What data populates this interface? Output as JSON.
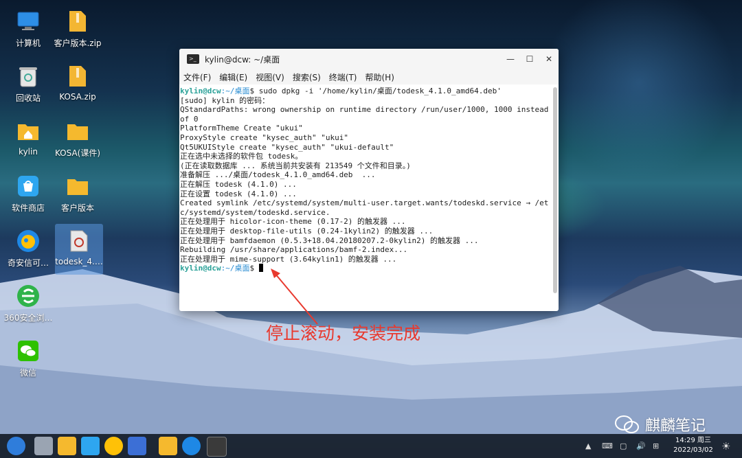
{
  "desktop": {
    "icons": [
      {
        "label": "计算机",
        "icon": "computer-icon"
      },
      {
        "label": "客户版本.zip",
        "icon": "zip-icon"
      },
      {
        "label": "回收站",
        "icon": "trash-icon"
      },
      {
        "label": "KOSA.zip",
        "icon": "zip-icon"
      },
      {
        "label": "kylin",
        "icon": "home-folder-icon"
      },
      {
        "label": "KOSA(课件)",
        "icon": "folder-icon"
      },
      {
        "label": "软件商店",
        "icon": "store-icon"
      },
      {
        "label": "客户版本",
        "icon": "folder-icon"
      },
      {
        "label": "奇安信可…",
        "icon": "browser-icon"
      },
      {
        "label": "todesk_4.…",
        "icon": "deb-package-icon"
      },
      {
        "label": "360安全浏…",
        "icon": "360-browser-icon"
      },
      {
        "label": "微信",
        "icon": "wechat-icon"
      }
    ]
  },
  "terminal": {
    "title": "kylin@dcw: ~/桌面",
    "menu": [
      "文件(F)",
      "编辑(E)",
      "视图(V)",
      "搜索(S)",
      "终端(T)",
      "帮助(H)"
    ],
    "prompt_user": "kylin@dcw",
    "prompt_path": ":~/桌面",
    "prompt_end": "$ ",
    "command": "sudo dpkg -i '/home/kylin/桌面/todesk_4.1.0_amd64.deb'",
    "output": "[sudo] kylin 的密码：\nQStandardPaths: wrong ownership on runtime directory /run/user/1000, 1000 instead of 0\nPlatformTheme Create \"ukui\"\nProxyStyle create \"kysec_auth\" \"ukui\"\nQt5UKUIStyle create \"kysec_auth\" \"ukui-default\"\n正在选中未选择的软件包 todesk。\n(正在读取数据库 ... 系统当前共安装有 213549 个文件和目录。)\n准备解压 .../桌面/todesk_4.1.0_amd64.deb  ...\n正在解压 todesk (4.1.0) ...\n正在设置 todesk (4.1.0) ...\nCreated symlink /etc/systemd/system/multi-user.target.wants/todeskd.service → /etc/systemd/system/todeskd.service.\n正在处理用于 hicolor-icon-theme (0.17-2) 的触发器 ...\n正在处理用于 desktop-file-utils (0.24-1kylin2) 的触发器 ...\n正在处理用于 bamfdaemon (0.5.3+18.04.20180207.2-0kylin2) 的触发器 ...\nRebuilding /usr/share/applications/bamf-2.index...\n正在处理用于 mime-support (3.64kylin1) 的触发器 ..."
  },
  "annotation": "停止滚动，安装完成",
  "watermark": "麒麟笔记",
  "taskbar": {
    "time": "14:29 周三",
    "date": "2022/03/02"
  },
  "colors": {
    "annotation": "#e8392e",
    "prompt_user": "#2aa198",
    "prompt_path": "#268bd2"
  }
}
